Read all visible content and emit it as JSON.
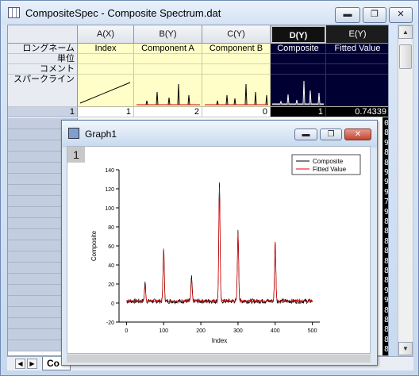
{
  "window": {
    "title": "CompositeSpec - Composite Spectrum.dat",
    "buttons": [
      "▬",
      "❐",
      "✕"
    ]
  },
  "columns": [
    {
      "name": "A(X)",
      "long_name": "Index"
    },
    {
      "name": "B(Y)",
      "long_name": "Component  A"
    },
    {
      "name": "C(Y)",
      "long_name": "Component  B"
    },
    {
      "name": "D(Y)",
      "long_name": "Composite"
    },
    {
      "name": "E(Y)",
      "long_name": "Fitted Value"
    }
  ],
  "row_labels": {
    "long_name": "ロングネーム",
    "units": "単位",
    "comments": "コメント",
    "sparklines": "スパークライン"
  },
  "first_row": {
    "index": "1",
    "values": [
      "1",
      "2",
      "0",
      "1",
      "0.74339"
    ]
  },
  "right_strip_digits": [
    "0",
    "8",
    "9",
    "8",
    "8",
    "9",
    "9",
    "9",
    "7",
    "9",
    "8",
    "8",
    "8",
    "8",
    "8",
    "8",
    "8",
    "9",
    "9",
    "8",
    "8",
    "8",
    "8",
    "8",
    "8",
    "8",
    "9",
    "9",
    "9",
    "9",
    "8"
  ],
  "sheet_tab": "Co",
  "tab_nav": [
    "◀",
    "▶"
  ],
  "scroll": {
    "up": "▲",
    "down": "▼"
  },
  "graph": {
    "title": "Graph1",
    "page_number": "1",
    "buttons": [
      "▬",
      "❐",
      "✕"
    ],
    "legend": [
      {
        "name": "Composite",
        "color": "#000000"
      },
      {
        "name": "Fitted Value",
        "color": "#e00000"
      }
    ]
  },
  "chart_data": {
    "type": "line",
    "xlabel": "Index",
    "ylabel": "Composite",
    "xlim": [
      -20,
      520
    ],
    "ylim": [
      -20,
      140
    ],
    "xticks": [
      0,
      100,
      200,
      300,
      400,
      500
    ],
    "yticks": [
      -20,
      0,
      20,
      40,
      60,
      80,
      100,
      120,
      140
    ],
    "baseline": 2,
    "peaks": [
      {
        "x": 50,
        "composite": 21,
        "fitted": 18
      },
      {
        "x": 100,
        "composite": 58,
        "fitted": 56
      },
      {
        "x": 175,
        "composite": 27,
        "fitted": 24
      },
      {
        "x": 250,
        "composite": 128,
        "fitted": 123
      },
      {
        "x": 300,
        "composite": 75,
        "fitted": 73
      },
      {
        "x": 400,
        "composite": 66,
        "fitted": 65
      }
    ],
    "series": [
      {
        "name": "Composite",
        "color": "#000000"
      },
      {
        "name": "Fitted Value",
        "color": "#e00000"
      }
    ],
    "legend_position": "top-right",
    "grid": false
  }
}
